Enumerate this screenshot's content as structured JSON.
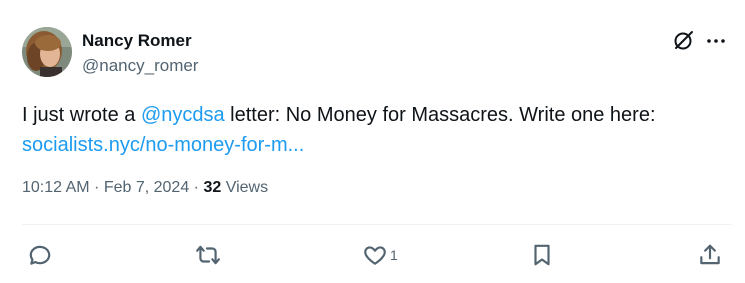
{
  "author": {
    "name": "Nancy Romer",
    "handle": "@nancy_romer"
  },
  "tweet": {
    "text_1": "I just wrote a ",
    "mention": "@nycdsa",
    "text_2": " letter: No Money for Massacres. Write one here:",
    "link": "socialists.nyc/no-money-for-m..."
  },
  "meta": {
    "time": "10:12 AM",
    "sep1": " · ",
    "date": "Feb 7, 2024",
    "sep2": " · ",
    "views_count": "32",
    "views_label": " Views"
  },
  "actions": {
    "reply_icon": "reply-icon",
    "retweet_icon": "retweet-icon",
    "like_icon": "heart-icon",
    "like_count": "1",
    "bookmark_icon": "bookmark-icon",
    "share_icon": "share-icon"
  },
  "colors": {
    "link": "#1d9bf0",
    "text": "#0f1419",
    "secondary": "#536471",
    "divider": "#eff3f4"
  }
}
